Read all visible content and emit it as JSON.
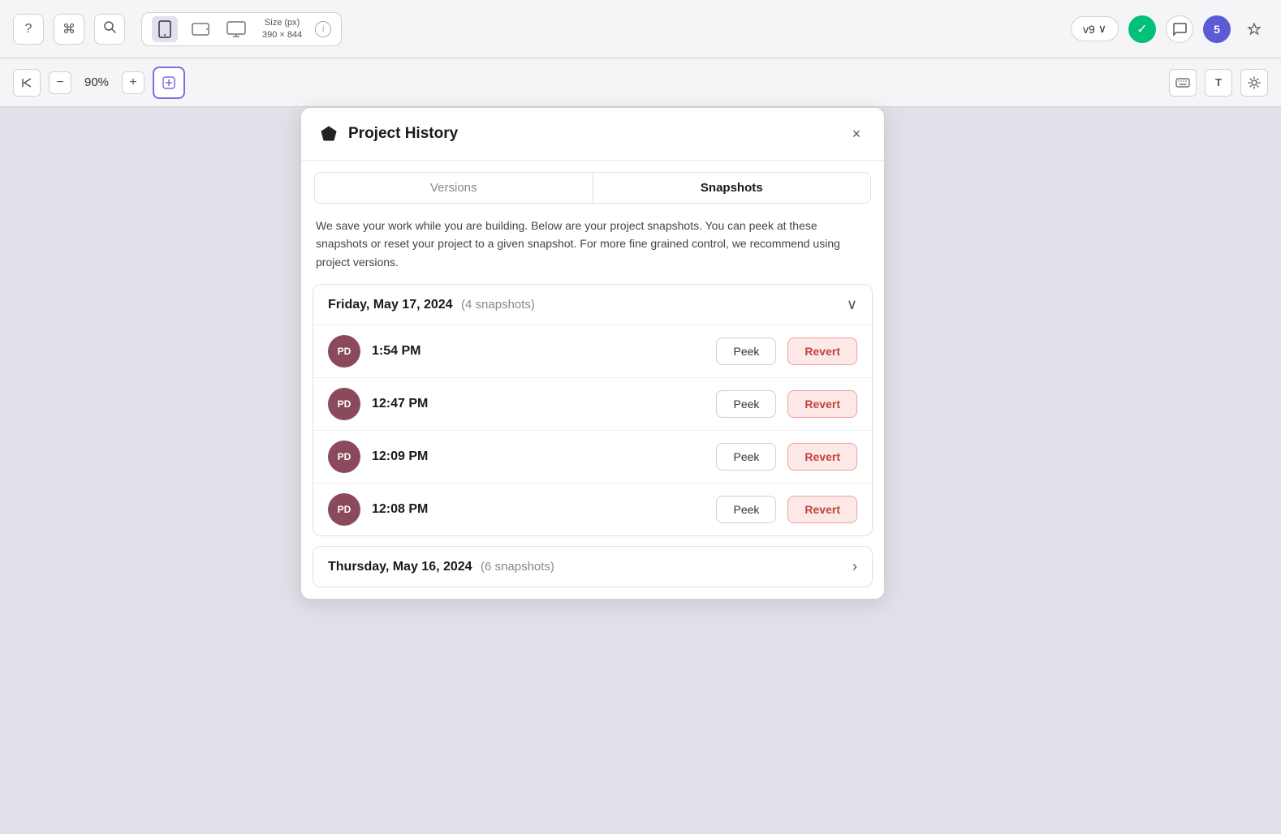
{
  "topToolbar": {
    "helpIcon": "?",
    "commandIcon": "⌘",
    "searchIcon": "🔍",
    "deviceMobile": "📱",
    "deviceTablet": "⬜",
    "deviceDesktop": "🖥",
    "sizeLabel": "Size (px)",
    "sizeValue": "390 × 844",
    "infoIcon": "i",
    "versionLabel": "v9",
    "chevronDown": "∨",
    "commentIcon": "💬",
    "avatarLabel": "5",
    "menuIcon": "⚡"
  },
  "secondaryToolbar": {
    "navLeft": "⏮",
    "zoomMinus": "−",
    "zoomValue": "90%",
    "zoomPlus": "+",
    "activeToolIcon": "✦",
    "keyboardIcon": "⌨",
    "textSizeIcon": "T↕",
    "settingsIcon": "⚙"
  },
  "panel": {
    "title": "Project History",
    "icon": "◆",
    "closeIcon": "×",
    "tabs": [
      {
        "id": "versions",
        "label": "Versions",
        "active": false
      },
      {
        "id": "snapshots",
        "label": "Snapshots",
        "active": true
      }
    ],
    "description": "We save your work while you are building. Below are your project snapshots. You can peek at these snapshots or reset your project to a given snapshot. For more fine grained control, we recommend using project versions.",
    "groups": [
      {
        "id": "may17",
        "date": "Friday, May 17, 2024",
        "count": "4 snapshots",
        "expanded": true,
        "chevron": "∨",
        "snapshots": [
          {
            "id": "s1",
            "initials": "PD",
            "time": "1:54 PM",
            "peekLabel": "Peek",
            "revertLabel": "Revert"
          },
          {
            "id": "s2",
            "initials": "PD",
            "time": "12:47 PM",
            "peekLabel": "Peek",
            "revertLabel": "Revert"
          },
          {
            "id": "s3",
            "initials": "PD",
            "time": "12:09 PM",
            "peekLabel": "Peek",
            "revertLabel": "Revert"
          },
          {
            "id": "s4",
            "initials": "PD",
            "time": "12:08 PM",
            "peekLabel": "Peek",
            "revertLabel": "Revert"
          }
        ]
      },
      {
        "id": "may16",
        "date": "Thursday, May 16, 2024",
        "count": "6 snapshots",
        "expanded": false,
        "chevron": "›",
        "snapshots": []
      }
    ]
  }
}
